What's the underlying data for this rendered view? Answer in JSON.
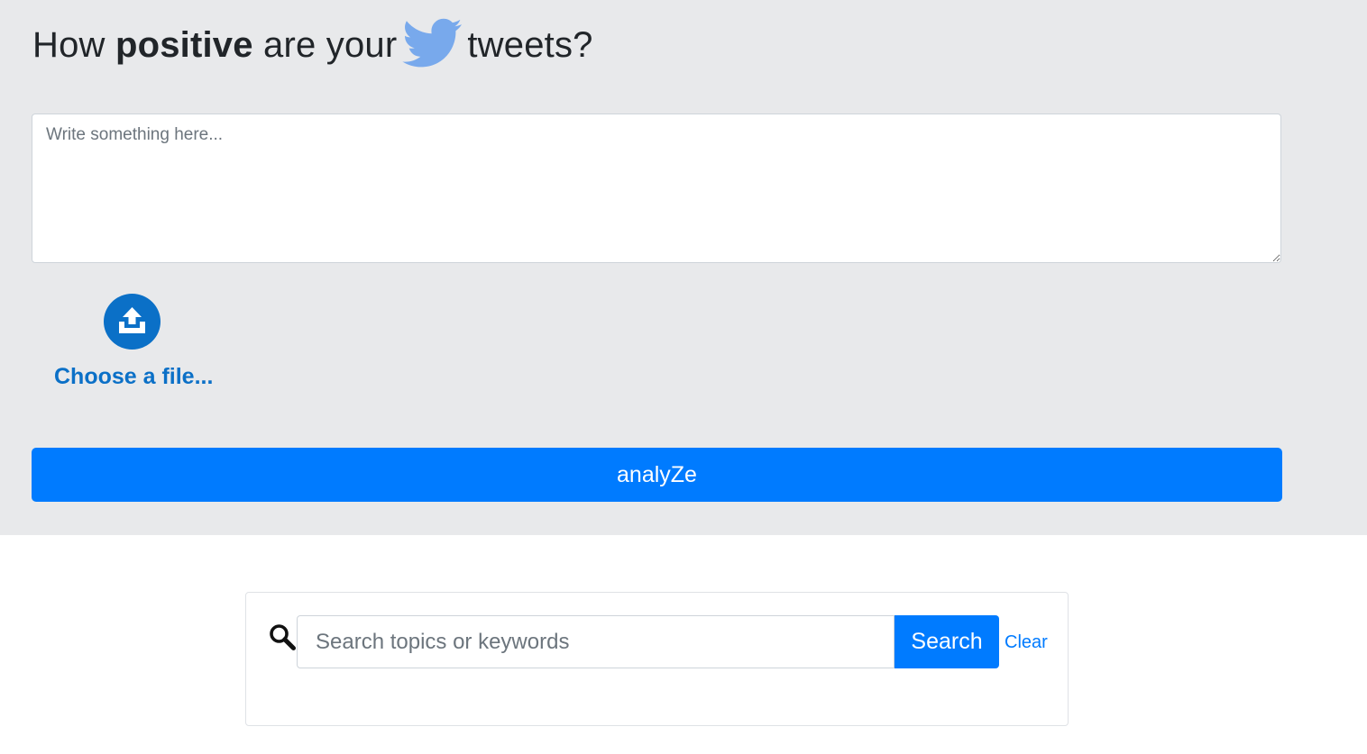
{
  "header": {
    "title_prefix": "How ",
    "title_emphasis": "positive",
    "title_middle": " are your",
    "title_suffix": "tweets?",
    "bird_icon": "twitter-bird-icon",
    "bird_color": "#78a9ec"
  },
  "composer": {
    "placeholder": "Write something here...",
    "value": ""
  },
  "upload": {
    "icon": "upload-icon",
    "label": "Choose a file...",
    "color": "#0b70c7"
  },
  "analyze": {
    "label": "analyZe",
    "color": "#007bff"
  },
  "search": {
    "icon": "magnifier-icon",
    "placeholder": "Search topics or keywords",
    "value": "",
    "button_label": "Search",
    "clear_label": "Clear"
  },
  "colors": {
    "hero_background": "#e8e9eb",
    "primary": "#007bff"
  }
}
